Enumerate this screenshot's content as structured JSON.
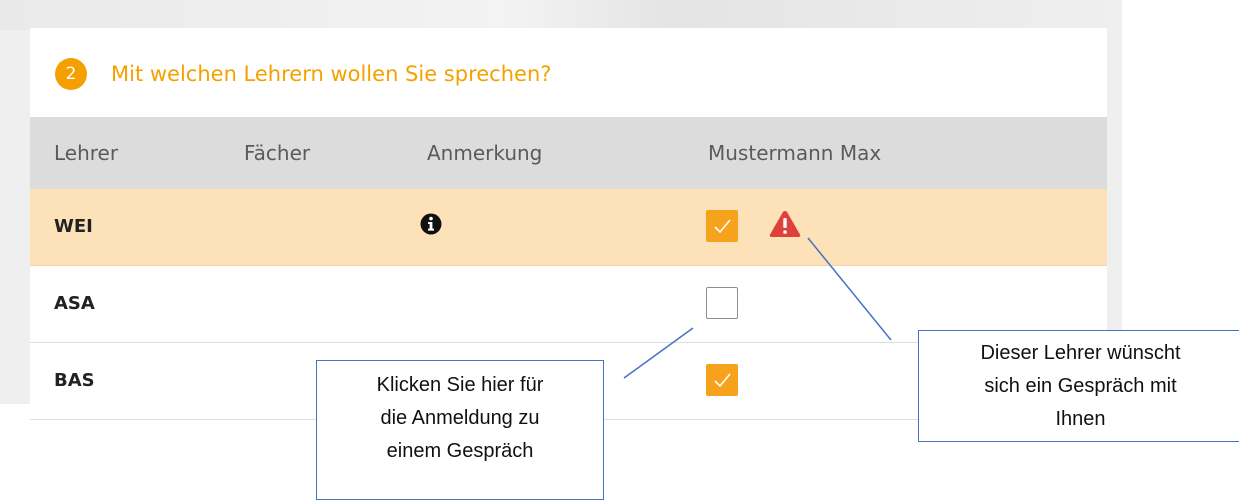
{
  "step": {
    "number": "2",
    "title": "Mit welchen Lehrern wollen Sie sprechen?"
  },
  "table": {
    "headers": {
      "teacher": "Lehrer",
      "subjects": "Fächer",
      "note": "Anmerkung",
      "student": "Mustermann Max"
    },
    "rows": [
      {
        "teacher": "WEI",
        "subjects": "",
        "has_note": true,
        "selected": true,
        "teacher_requests": true,
        "highlighted": true
      },
      {
        "teacher": "ASA",
        "subjects": "",
        "has_note": false,
        "selected": false,
        "teacher_requests": false,
        "highlighted": false
      },
      {
        "teacher": "BAS",
        "subjects": "",
        "has_note": false,
        "selected": true,
        "teacher_requests": false,
        "highlighted": false
      }
    ]
  },
  "icons": {
    "info": "info-circle-icon",
    "warning": "warning-triangle-icon",
    "check": "checkmark-icon"
  },
  "callouts": {
    "checkbox_hint": [
      "Klicken Sie hier für",
      "die Anmeldung zu",
      "einem Gespräch"
    ],
    "warning_hint": [
      "Dieser Lehrer wünscht",
      "sich ein Gespräch mit",
      "Ihnen"
    ]
  },
  "colors": {
    "accent": "#f5a000",
    "checkbox_checked": "#f7a21c",
    "row_highlight": "#fde2b9",
    "warning": "#e0403a",
    "header_bg": "#dcdcdc",
    "callout_border": "#4472c4"
  }
}
